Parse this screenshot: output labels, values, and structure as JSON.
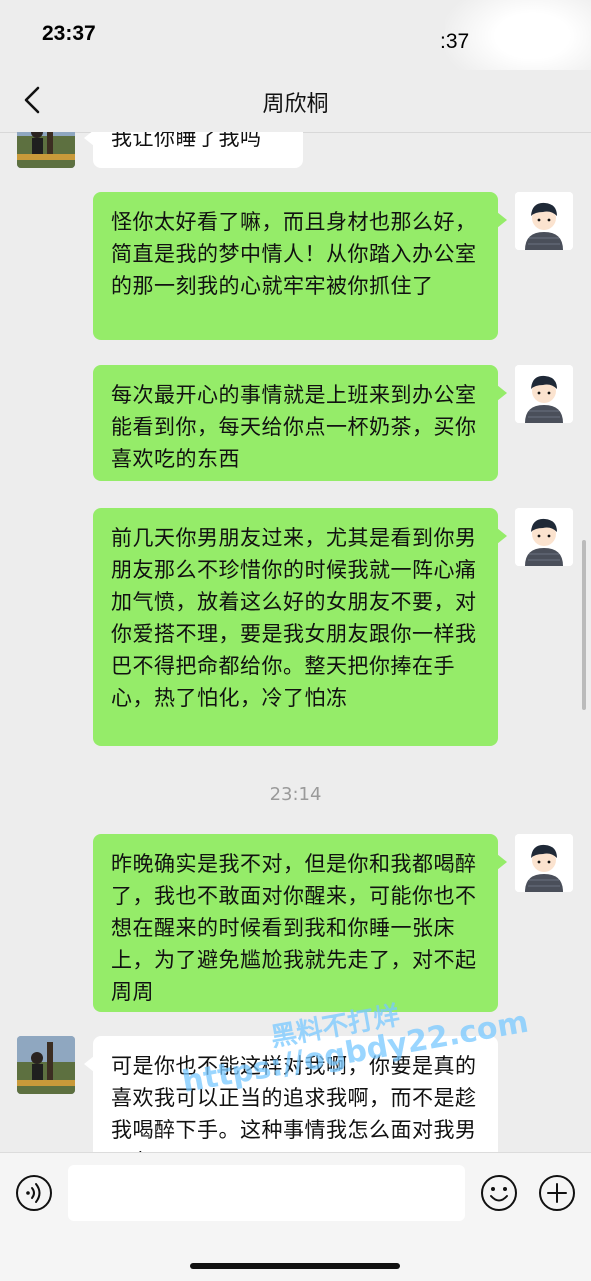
{
  "status_bar": {
    "time": "23:37",
    "time_secondary": ":37"
  },
  "nav": {
    "title": "周欣桐",
    "back_icon": "chevron-left-icon"
  },
  "messages": [
    {
      "sender": "her",
      "text": "我让你睡了我吗"
    },
    {
      "sender": "me",
      "text": "怪你太好看了嘛，而且身材也那么好，简直是我的梦中情人！从你踏入办公室的那一刻我的心就牢牢被你抓住了"
    },
    {
      "sender": "me",
      "text": "每次最开心的事情就是上班来到办公室能看到你，每天给你点一杯奶茶，买你喜欢吃的东西"
    },
    {
      "sender": "me",
      "text": "前几天你男朋友过来，尤其是看到你男朋友那么不珍惜你的时候我就一阵心痛加气愤，放着这么好的女朋友不要，对你爱搭不理，要是我女朋友跟你一样我巴不得把命都给你。整天把你捧在手心，热了怕化，冷了怕冻"
    },
    {
      "sender": "me",
      "text": "昨晚确实是我不对，但是你和我都喝醉了，我也不敢面对你醒来，可能你也不想在醒来的时候看到我和你睡一张床上，为了避免尴尬我就先走了，对不起周周"
    },
    {
      "sender": "her",
      "text": "可是你也不能这样对我啊，你要是真的喜欢我可以正当的追求我啊，而不是趁我喝醉下手。这种事情我怎么面对我男朋友"
    }
  ],
  "timestamp": "23:14",
  "watermark": {
    "line1": "黑料不打烊",
    "line2": "https://ogbdy22.com"
  },
  "input_bar": {
    "voice_icon": "voice-icon",
    "emoji_icon": "emoji-icon",
    "add_icon": "plus-circle-icon",
    "value": ""
  },
  "colors": {
    "bubble_me": "#95ec69",
    "bubble_her": "#ffffff",
    "background": "#ededed"
  }
}
